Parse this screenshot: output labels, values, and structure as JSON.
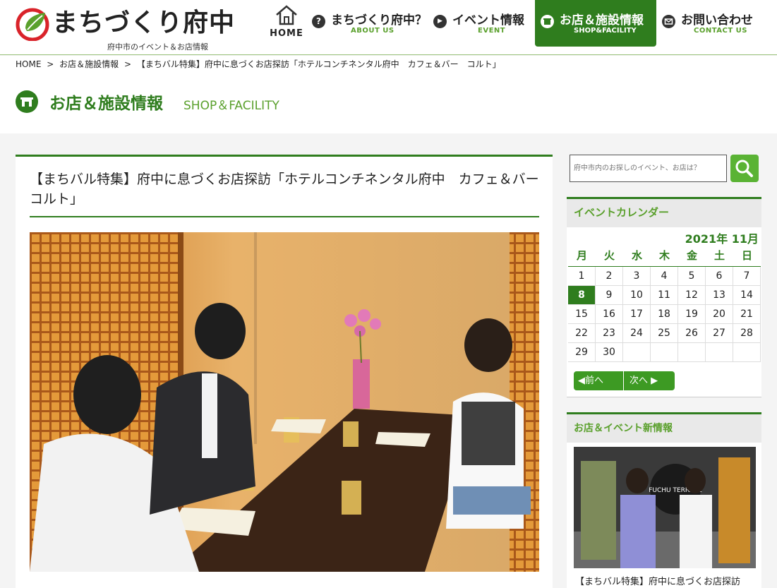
{
  "header": {
    "logo_text": "まちづくり府中",
    "logo_sub": "府中市のイベント＆お店情報",
    "nav": {
      "home": "HOME",
      "about_jp": "まちづくり府中？",
      "about_en": "ABOUT US",
      "event_jp": "イベント情報",
      "event_en": "EVENT",
      "shop_jp": "お店＆施設情報",
      "shop_en": "SHOP&FACILITY",
      "contact_jp": "お問い合わせ",
      "contact_en": "CONTACT US"
    }
  },
  "breadcrumb": [
    "HOME",
    ">",
    "お店＆施設情報",
    ">",
    "【まちバル特集】府中に息づくお店探訪「ホテルコンチネンタル府中　カフェ＆バー　コルト」"
  ],
  "page": {
    "title": "お店＆施設情報",
    "title_en": "SHOP＆FACILITY"
  },
  "article": {
    "title": "【まちバル特集】府中に息づくお店探訪「ホテルコンチネンタル府中　カフェ＆バー　コルト」"
  },
  "search": {
    "placeholder": "府中市内のお探しのイベント、お店は？"
  },
  "calendar": {
    "heading": "イベントカレンダー",
    "month_label": "2021年 11月",
    "weekdays": [
      "月",
      "火",
      "水",
      "木",
      "金",
      "土",
      "日"
    ],
    "weeks": [
      [
        "1",
        "2",
        "3",
        "4",
        "5",
        "6",
        "7"
      ],
      [
        "8",
        "9",
        "10",
        "11",
        "12",
        "13",
        "14"
      ],
      [
        "15",
        "16",
        "17",
        "18",
        "19",
        "20",
        "21"
      ],
      [
        "22",
        "23",
        "24",
        "25",
        "26",
        "27",
        "28"
      ],
      [
        "29",
        "30",
        "",
        "",
        "",
        "",
        ""
      ]
    ],
    "today": "8",
    "prev_label": "◀前へ",
    "next_label": "次へ ▶"
  },
  "news": {
    "heading": "お店＆イベント新情報",
    "caption": "【まちバル特集】府中に息づくお店探訪",
    "sign_text": "FUCHU TERRACE"
  },
  "colors": {
    "brand_green": "#2f7d1e",
    "accent_green": "#5aa02c",
    "logo_red": "#d9232a"
  }
}
